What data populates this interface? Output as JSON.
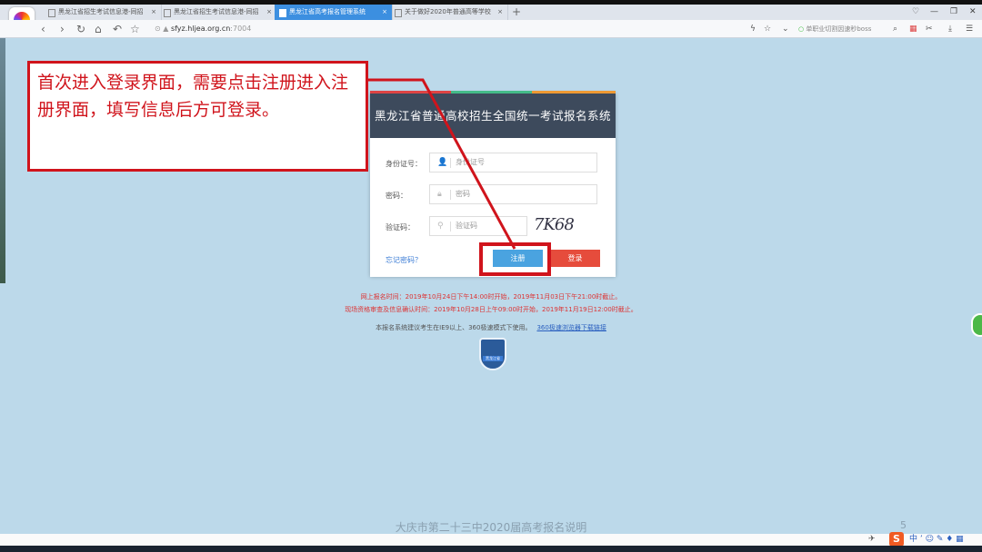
{
  "browser": {
    "tabs": [
      {
        "label": "黑龙江省招生考试信息港-同招",
        "active": false
      },
      {
        "label": "黑龙江省招生考试信息港-同招",
        "active": false
      },
      {
        "label": "黑龙江省高考报名管理系统",
        "active": true
      },
      {
        "label": "关于做好2020年普通高等学校",
        "active": false
      }
    ],
    "url_host": "sfyz.hljea.org.cn",
    "url_port": ":7004",
    "search_hint": "单职业切割因速秒boss"
  },
  "annotation": "首次进入登录界面，需要点击注册进入注册界面，填写信息后方可登录。",
  "login": {
    "title": "黑龙江省普通高校招生全国统一考试报名系统",
    "id_label": "身份证号：",
    "id_placeholder": "身份证号",
    "pwd_label": "密码：",
    "pwd_placeholder": "密码",
    "code_label": "验证码：",
    "code_placeholder": "验证码",
    "captcha": "7K68",
    "forgot": "忘记密码？",
    "register": "注册",
    "login": "登录"
  },
  "notices": [
    "网上报名时间：2019年10月24日下午14:00时开始，2019年11月03日下午21:00时截止。",
    "现场资格审查及信息确认时间：2019年10月28日上午09:00时开始，2019年11月19日12:00时截止。"
  ],
  "tip": "本报名系统建议考生在IE9以上、360极速模式下使用。",
  "tip_link": "360极速浏览器下载链接",
  "badge": "黑龙江省",
  "footer": "大庆市第二十三中2020届高考报名说明",
  "page_number": "5",
  "ime": {
    "logo": "S",
    "mode": "中"
  }
}
